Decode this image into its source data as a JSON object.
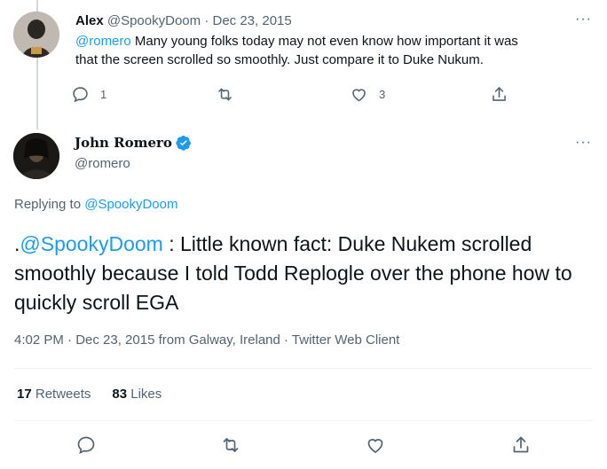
{
  "reply_tweet": {
    "author_name": "Alex",
    "handle": "@SpookyDoom",
    "separator": "·",
    "date": "Dec 23, 2015",
    "mention": "@romero",
    "text_line1": " Many young folks today may not even know how important it was",
    "text_line2": "that the screen scrolled so smoothly. Just compare it to Duke Nukum.",
    "reply_count": "1",
    "retweet_count": "",
    "like_count": "3"
  },
  "main_tweet": {
    "display_name": "John Romero",
    "handle": "@romero",
    "replying_prefix": "Replying to ",
    "replying_to": "@SpookyDoom",
    "text_prefix": ".",
    "text_mention": "@SpookyDoom",
    "text_body": " : Little known fact: Duke Nukem scrolled smoothly because I told Todd Replogle over the phone how to quickly scroll EGA",
    "meta": "4:02 PM · Dec 23, 2015 from Galway, Ireland · Twitter Web Client",
    "retweets_count": "17",
    "retweets_label": " Retweets",
    "likes_count": "83",
    "likes_label": " Likes"
  },
  "more_glyph": "···",
  "colors": {
    "accent": "#1d9bf0",
    "muted": "#536471",
    "text": "#0f1419",
    "thread_line": "#cfd9de"
  },
  "icons": [
    "reply-icon",
    "retweet-icon",
    "like-icon",
    "share-icon",
    "verified-badge-icon",
    "more-icon"
  ]
}
